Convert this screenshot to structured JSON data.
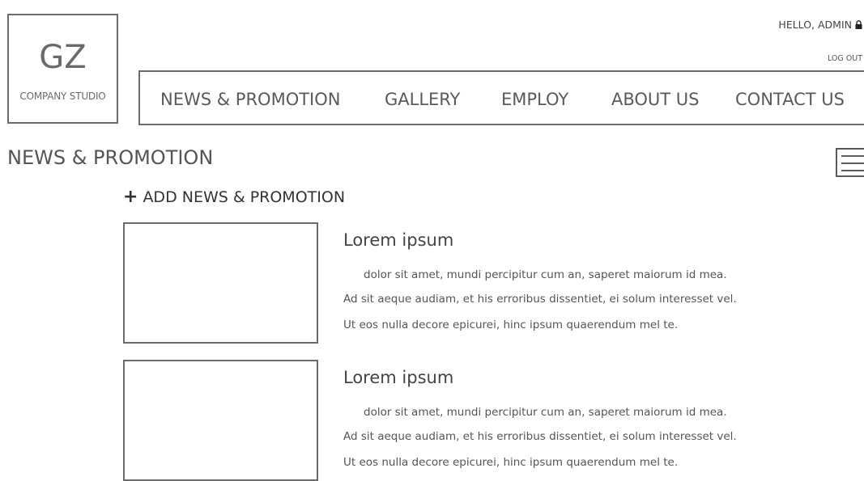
{
  "logo": {
    "mark": "GZ",
    "subtitle": "COMPANY STUDIO"
  },
  "user": {
    "greeting": "HELLO, ADMIN",
    "logout": "LOG OUT"
  },
  "nav": {
    "items": [
      {
        "label": "NEWS & PROMOTION"
      },
      {
        "label": "GALLERY"
      },
      {
        "label": "EMPLOY"
      },
      {
        "label": "ABOUT US"
      },
      {
        "label": "CONTACT US"
      }
    ]
  },
  "page": {
    "title": "NEWS & PROMOTION",
    "add_label": "ADD NEWS & PROMOTION",
    "add_icon": "+"
  },
  "posts": [
    {
      "title": "Lorem ipsum",
      "lines": [
        "dolor sit amet, mundi percipitur cum an, saperet maiorum id mea.",
        "Ad sit aeque audiam, et his erroribus dissentiet, ei solum interesset vel.",
        "Ut eos nulla decore epicurei, hinc ipsum quaerendum mel te."
      ]
    },
    {
      "title": "Lorem ipsum",
      "lines": [
        "dolor sit amet, mundi percipitur cum an, saperet maiorum id mea.",
        "Ad sit aeque audiam, et his erroribus dissentiet, ei solum interesset vel.",
        "Ut eos nulla decore epicurei, hinc ipsum quaerendum mel te."
      ]
    }
  ],
  "icons": {
    "lock": "lock-icon",
    "menu": "hamburger-menu-icon",
    "add": "plus-icon"
  },
  "colors": {
    "border": "#6b6b6b",
    "text": "#555555",
    "background": "#ffffff"
  }
}
